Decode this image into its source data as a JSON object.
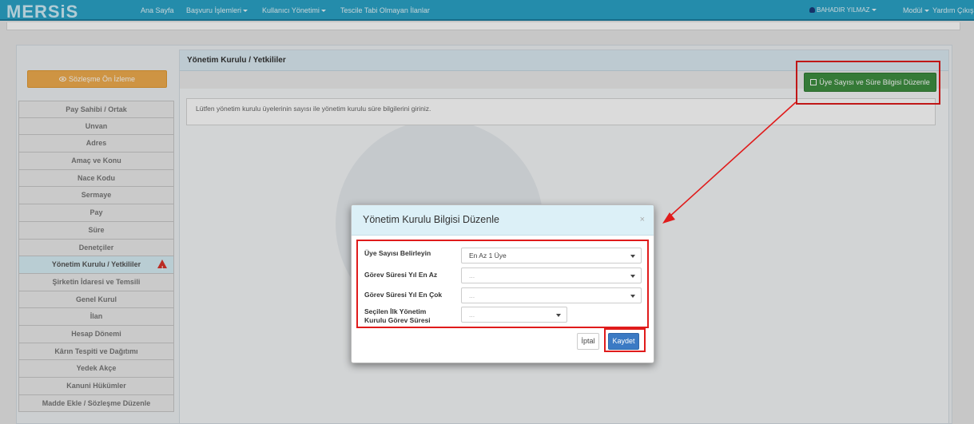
{
  "app": {
    "logo": "MERSiS"
  },
  "topnav": {
    "items": [
      {
        "label": "Ana Sayfa"
      },
      {
        "label": "Başvuru İşlemleri"
      },
      {
        "label": "Kullanıcı Yönetimi"
      },
      {
        "label": "Tescile Tabi Olmayan İlanlar"
      }
    ],
    "user": "BAHADIR YILMAZ",
    "module": "Modül",
    "help": "Yardım",
    "logout": "Çıkış"
  },
  "sidebar": {
    "preview_button": "Sözleşme Ön İzleme",
    "items": [
      {
        "label": "Pay Sahibi / Ortak"
      },
      {
        "label": "Unvan"
      },
      {
        "label": "Adres"
      },
      {
        "label": "Amaç ve Konu"
      },
      {
        "label": "Nace Kodu"
      },
      {
        "label": "Sermaye"
      },
      {
        "label": "Pay"
      },
      {
        "label": "Süre"
      },
      {
        "label": "Denetçiler"
      },
      {
        "label": "Yönetim Kurulu / Yetkililer"
      },
      {
        "label": "Şirketin İdaresi ve Temsili"
      },
      {
        "label": "Genel Kurul"
      },
      {
        "label": "İlan"
      },
      {
        "label": "Hesap Dönemi"
      },
      {
        "label": "Kârın Tespiti ve Dağıtımı"
      },
      {
        "label": "Yedek Akçe"
      },
      {
        "label": "Kanuni Hükümler"
      },
      {
        "label": "Madde Ekle / Sözleşme Düzenle"
      }
    ]
  },
  "main": {
    "title": "Yönetim Kurulu / Yetkililer",
    "edit_button": "Üye Sayısı ve Süre Bilgisi Düzenle",
    "info": "Lütfen yönetim kurulu üyelerinin sayısı ile yönetim kurulu süre bilgilerini giriniz."
  },
  "modal": {
    "title": "Yönetim Kurulu Bilgisi Düzenle",
    "close": "×",
    "fields": [
      {
        "label": "Üye Sayısı Belirleyin",
        "value": "En Az 1 Üye"
      },
      {
        "label": "Görev Süresi Yıl En Az",
        "value": "..."
      },
      {
        "label": "Görev Süresi Yıl En Çok",
        "value": "..."
      },
      {
        "label": "Seçilen İlk Yönetim Kurulu Görev Süresi",
        "value": "..."
      }
    ],
    "cancel": "İptal",
    "save": "Kaydet"
  },
  "colors": {
    "nav": "#2aa3c7",
    "preview_button": "#f0ad4e",
    "edit_button": "#3e8e41",
    "save_button": "#3b7ac4",
    "highlight": "#e01b1b",
    "warning": "#d9342b"
  }
}
